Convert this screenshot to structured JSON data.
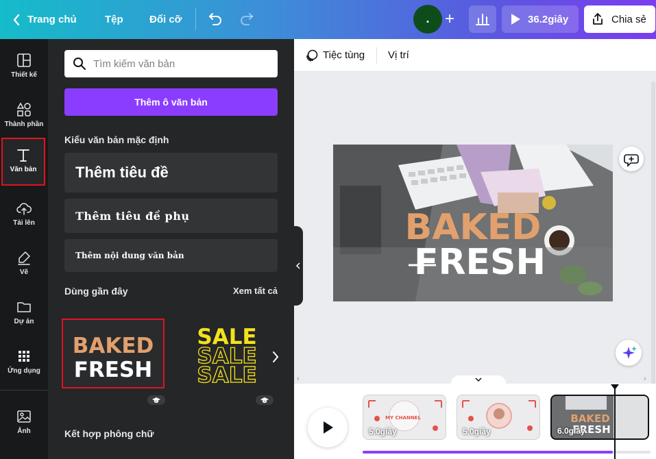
{
  "topbar": {
    "back_label": "Trang chủ",
    "file_label": "Tệp",
    "resize_label": "Đổi cỡ",
    "avatar_initial": ".",
    "add_label": "+",
    "duration": "36.2giây",
    "share_label": "Chia sẻ"
  },
  "rail": {
    "items": [
      {
        "label": "Thiết kế",
        "icon": "layout-icon"
      },
      {
        "label": "Thành phần",
        "icon": "shapes-icon"
      },
      {
        "label": "Văn bản",
        "icon": "text-icon",
        "active": true
      },
      {
        "label": "Tải lên",
        "icon": "upload-cloud-icon"
      },
      {
        "label": "Vẽ",
        "icon": "draw-pen-icon"
      },
      {
        "label": "Dự án",
        "icon": "folder-icon"
      },
      {
        "label": "Ứng dụng",
        "icon": "apps-grid-icon"
      },
      {
        "label": "Ảnh",
        "icon": "image-icon"
      }
    ]
  },
  "panel": {
    "search_placeholder": "Tìm kiếm văn bản",
    "add_textbox_label": "Thêm ô văn bản",
    "default_styles_title": "Kiểu văn bản mặc định",
    "heading_label": "Thêm tiêu đề",
    "subheading_label": "Thêm tiêu đề phụ",
    "body_label": "Thêm nội dung văn bản",
    "recent_title": "Dùng gần đây",
    "see_all_label": "Xem tất cả",
    "recent": [
      {
        "line1": "BAKED",
        "line2": "FRESH"
      },
      {
        "line1": "SALE",
        "line2": "SALE",
        "line3": "SALE"
      }
    ],
    "font_combos_title": "Kết hợp phông chữ"
  },
  "editor": {
    "toolbar": {
      "party_label": "Tiệc tùng",
      "position_label": "Vị trí"
    },
    "canvas_text": {
      "line1": "BAKED",
      "line2": "FRESH"
    }
  },
  "timeline": {
    "clips": [
      {
        "duration": "5.0giây",
        "title": "MY CHANNEL"
      },
      {
        "duration": "5.0giây"
      },
      {
        "duration": "6.0giây",
        "title1": "BAKED",
        "title2": "FRESH"
      }
    ],
    "progress": 0.87
  },
  "colors": {
    "accent": "#8b3dff",
    "highlight_border": "#e0141e",
    "baked_orange": "#e2a06d",
    "sale_yellow": "#f4e11c"
  }
}
